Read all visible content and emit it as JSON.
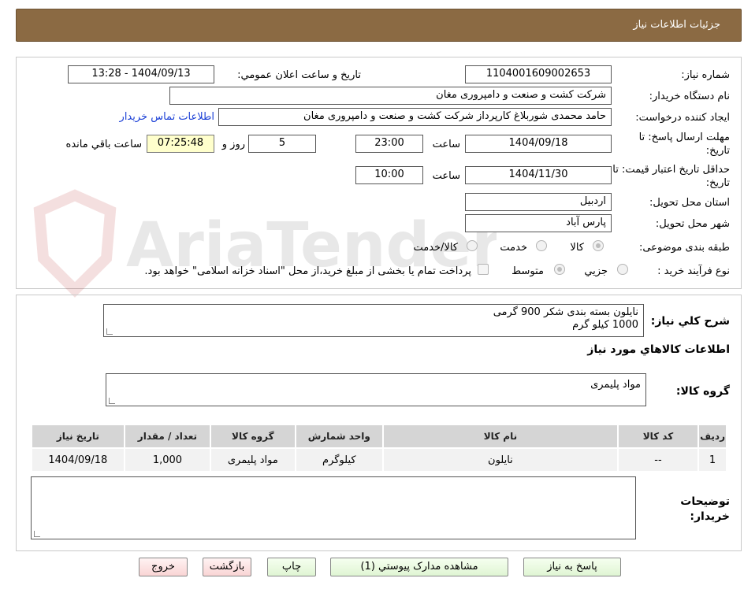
{
  "header": {
    "title": "جزئیات اطلاعات نیاز"
  },
  "watermark": {
    "text": "AriaTender.neT"
  },
  "form": {
    "need_number_label": "شماره نیاز:",
    "need_number": "1104001609002653",
    "announce_label": "تاریخ و ساعت اعلان عمومي:",
    "announce_value": "1404/09/13 - 13:28",
    "buyer_org_label": "نام دستگاه خریدار:",
    "buyer_org": "شرکت کشت و صنعت و دامپروری مغان",
    "creator_label": "ایجاد کننده درخواست:",
    "creator": "حامد محمدی شوربلاغ کارپرداز شرکت کشت و صنعت و دامپروری مغان",
    "contact_link": "اطلاعات تماس خریدار",
    "deadline_label": "مهلت ارسال پاسخ: تا تاریخ:",
    "deadline_date": "1404/09/18",
    "time_label": "ساعت",
    "deadline_time": "23:00",
    "days_value": "5",
    "days_label": "روز و",
    "remaining_time": "07:25:48",
    "remaining_label": "ساعت باقي مانده",
    "validity_label": "حداقل تاریخ اعتبار قیمت: تا تاریخ:",
    "validity_date": "1404/11/30",
    "validity_time": "10:00",
    "province_label": "استان محل تحویل:",
    "province": "اردبیل",
    "city_label": "شهر محل تحویل:",
    "city": "پارس آباد",
    "category_label": "طبقه بندی موضوعی:",
    "category_options": [
      "کالا",
      "خدمت",
      "کالا/خدمت"
    ],
    "process_label": "نوع فرآیند خرید :",
    "process_options": [
      "جزیي",
      "متوسط"
    ],
    "payment_note": "پرداخت تمام یا بخشی از مبلغ خرید،از محل \"اسناد خزانه اسلامی\" خواهد بود."
  },
  "description": {
    "label": "شرح کلي نیاز:",
    "line1": "نایلون بسته بندی شکر  900 گرمی",
    "line2": "1000 کیلو گرم"
  },
  "goods_section_title": "اطلاعات کالاهاي مورد نیاز",
  "goods_group": {
    "label": "گروه کالا:",
    "value": "مواد پلیمری"
  },
  "table": {
    "headers": [
      "ردیف",
      "کد کالا",
      "نام کالا",
      "واحد شمارش",
      "گروه کالا",
      "تعداد / مقدار",
      "تاریخ نیاز"
    ],
    "rows": [
      [
        "1",
        "--",
        "نایلون",
        "کیلوگرم",
        "مواد پلیمری",
        "1,000",
        "1404/09/18"
      ]
    ]
  },
  "buyer_notes": {
    "label_line1": "توضیحات",
    "label_line2": "خریدار:"
  },
  "buttons": {
    "reply": "پاسخ به نیاز",
    "attachments": "مشاهده مدارک پیوستي (1)",
    "print": "چاپ",
    "back": "بازگشت",
    "exit": "خروج"
  }
}
